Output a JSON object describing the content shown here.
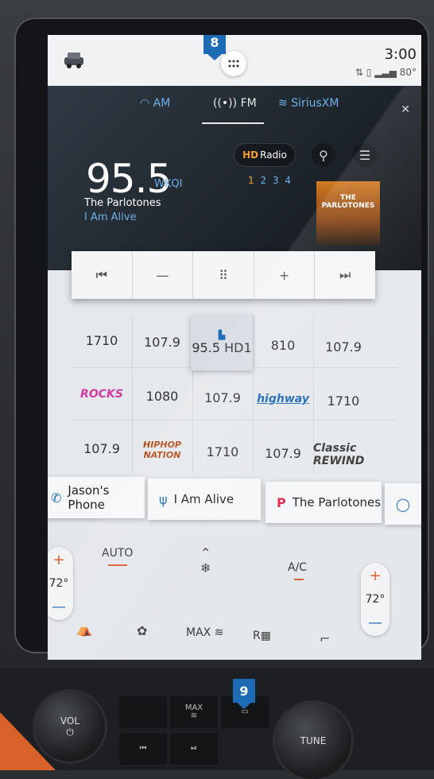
{
  "status": {
    "time": "3:00",
    "temperature": "80°"
  },
  "radio": {
    "bands": [
      "AM",
      "FM",
      "SiriusXM"
    ],
    "selected_band": "FM",
    "frequency": "95.5",
    "call_sign": "WKQI",
    "artist": "The Parlotones",
    "song": "I Am Alive",
    "hd_label": "Radio",
    "hd_prefix": "HD",
    "subchannels": [
      "1",
      "2",
      "3",
      "4"
    ],
    "album_art_text": "THE PARLOTONES"
  },
  "presets": [
    {
      "label": "1710"
    },
    {
      "label": "107.9"
    },
    {
      "label": "95.5 HD1"
    },
    {
      "label": "810"
    },
    {
      "label": "107.9"
    },
    {
      "label": "ROCKS"
    },
    {
      "label": "1080"
    },
    {
      "label": "107.9"
    },
    {
      "label": "highway"
    },
    {
      "label": "1710"
    },
    {
      "label": "107.9"
    },
    {
      "label": "HIPHOP NATION"
    },
    {
      "label": "1710"
    },
    {
      "label": "107.9"
    },
    {
      "label": "Classic REWIND"
    }
  ],
  "sources": [
    {
      "label": "Jason's Phone"
    },
    {
      "label": "I Am Alive"
    },
    {
      "label": "The Parlotones"
    }
  ],
  "climate": {
    "left_temp": "72°",
    "right_temp": "72°",
    "auto_label": "AUTO",
    "ac_label": "A/C",
    "max_label": "MAX",
    "rear_label": "R"
  },
  "hardware": {
    "vol_label": "VOL",
    "tune_label": "TUNE",
    "max_label": "MAX"
  },
  "callouts": [
    "8",
    "9"
  ],
  "colors": {
    "accent_blue": "#1d6ab5",
    "accent_orange": "#e05a2b",
    "hd_orange": "#f39c34",
    "light_blue": "#6fb1e8"
  }
}
